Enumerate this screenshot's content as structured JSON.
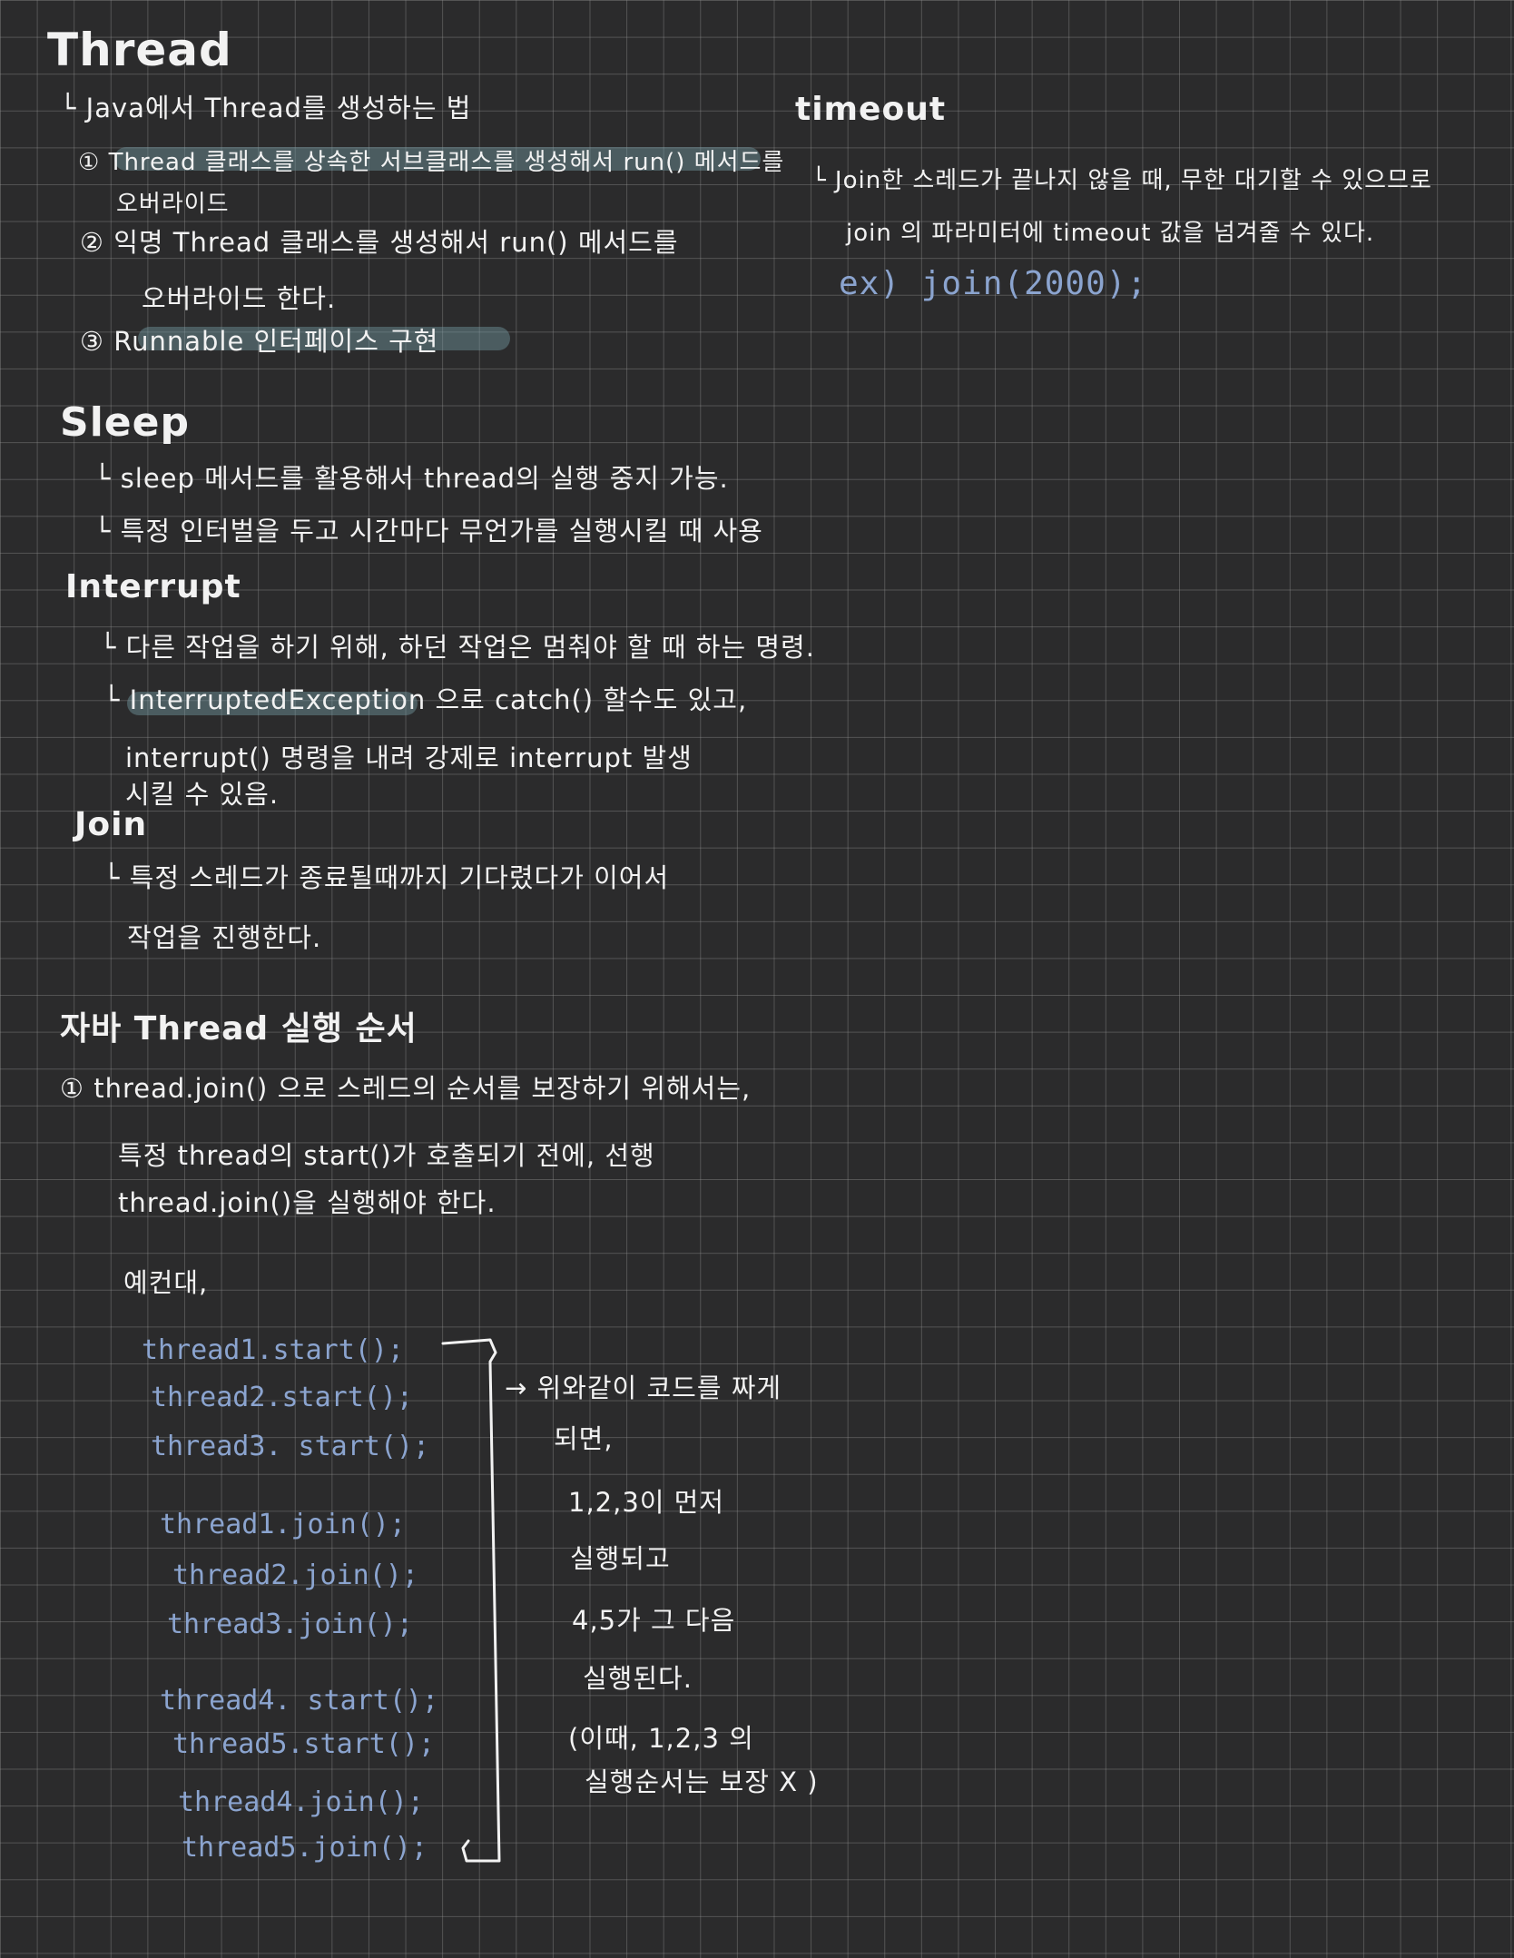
{
  "thread": {
    "title": "Thread",
    "subtitle": "└ Java에서 Thread를 생성하는 법",
    "item1_line1": "① Thread 클래스를 상속한 서브클래스를 생성해서 run() 메서드를",
    "item1_line2": "오버라이드",
    "item2_line1": "② 익명 Thread 클래스를 생성해서 run() 메서드를",
    "item2_line2": "오버라이드 한다.",
    "item3": "③  Runnable 인터페이스 구현"
  },
  "sleep": {
    "title": "Sleep",
    "line1": "└ sleep 메서드를 활용해서 thread의 실행 중지 가능.",
    "line2": "└ 특정 인터벌을 두고 시간마다 무언가를 실행시킬 때 사용"
  },
  "interrupt": {
    "title": "Interrupt",
    "line1": "└ 다른 작업을 하기 위해, 하던 작업은 멈춰야 할 때 하는 명령.",
    "line2": "└ InterruptedException 으로  catch() 할수도 있고,",
    "line3": "interrupt() 명령을 내려 강제로 interrupt 발생",
    "line4": "시킬 수 있음."
  },
  "join": {
    "title": "Join",
    "line1": "└ 특정 스레드가 종료될때까지 기다렸다가 이어서",
    "line2": "작업을 진행한다."
  },
  "order": {
    "title": "자바 Thread 실행 순서",
    "line1": "① thread.join() 으로 스레드의 순서를 보장하기 위해서는,",
    "line2": "특정 thread의 start()가 호출되기 전에, 선행",
    "line3": "thread.join()을 실행해야 한다.",
    "example": "예컨대,",
    "code": [
      "thread1.start();",
      "thread2.start();",
      "thread3. start();",
      "thread1.join();",
      "thread2.join();",
      "thread3.join();",
      "thread4. start();",
      "thread5.start();",
      "thread4.join();",
      "thread5.join();"
    ],
    "note1": "→ 위와같이 코드를 짜게",
    "note2": "되면,",
    "note3": "1,2,3이 먼저",
    "note4": "실행되고",
    "note5": "4,5가 그 다음",
    "note6": "실행된다.",
    "note7": "(이때, 1,2,3 의",
    "note8": "실행순서는 보장 X )"
  },
  "timeout": {
    "title": "timeout",
    "line1": "└ Join한 스레드가 끝나지 않을 때, 무한 대기할 수 있으므로",
    "line2": "join 의 파라미터에 timeout 값을 넘겨줄 수 있다.",
    "example": "ex) join(2000);"
  }
}
